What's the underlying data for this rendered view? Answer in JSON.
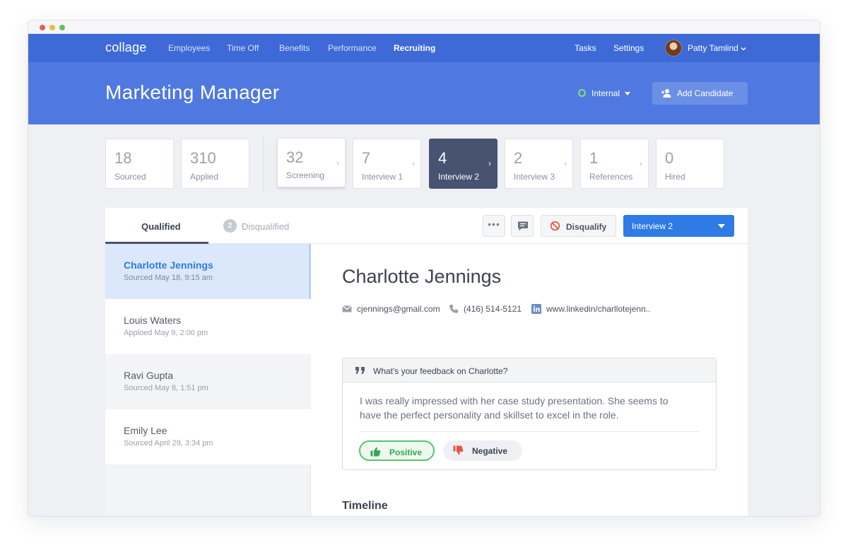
{
  "nav": {
    "logo": "collage",
    "links": [
      "Employees",
      "Time Off",
      "Benefits",
      "Performance",
      "Recruiting"
    ],
    "active_link": "Recruiting",
    "tasks": "Tasks",
    "settings": "Settings",
    "user_name": "Patty Tamlind"
  },
  "header": {
    "title": "Marketing Manager",
    "status": "Internal",
    "add_candidate": "Add Candidate"
  },
  "pipeline": {
    "summary": [
      {
        "count": "18",
        "label": "Sourced"
      },
      {
        "count": "310",
        "label": "Applied"
      }
    ],
    "stages": [
      {
        "count": "32",
        "label": "Screening"
      },
      {
        "count": "7",
        "label": "Interview 1"
      },
      {
        "count": "4",
        "label": "Interview 2"
      },
      {
        "count": "2",
        "label": "Interview 3"
      },
      {
        "count": "1",
        "label": "References"
      },
      {
        "count": "0",
        "label": "Hired"
      }
    ],
    "active_stage": "Interview 2"
  },
  "candidate_list": {
    "tabs": {
      "qualified": "Qualified",
      "disqualified": "Disqualified",
      "disqualified_count": "2"
    },
    "items": [
      {
        "name": "Charlotte Jennings",
        "meta": "Sourced May 18, 9:15 am"
      },
      {
        "name": "Louis Waters",
        "meta": "Apploed May 9, 2:00 pm"
      },
      {
        "name": "Ravi Gupta",
        "meta": "Sourced May 8, 1:51 pm"
      },
      {
        "name": "Emily Lee",
        "meta": "Sourced April 29, 3:34 pm"
      }
    ]
  },
  "toolbar": {
    "more": "•••",
    "disqualify": "Disqualify",
    "stage_select": "Interview 2"
  },
  "candidate": {
    "name": "Charlotte Jennings",
    "email": "cjennings@gmail.com",
    "phone": "(416) 514-5121",
    "linkedin": "www.linkedin/charllotejenn.."
  },
  "feedback": {
    "prompt": "What's your feedback on Charlotte?",
    "text": "I was really impressed with her case study presentation. She seems to have the perfect personality and skillset to excel in the role.",
    "positive": "Positive",
    "negative": "Negative"
  },
  "timeline": {
    "title": "Timeline"
  },
  "colors": {
    "nav_bg": "#3e6ad8",
    "header_bg": "#4f79e0",
    "active_stage_bg": "#485372",
    "primary": "#2e7be5",
    "positive": "#34a853",
    "negative": "#e5533d"
  }
}
